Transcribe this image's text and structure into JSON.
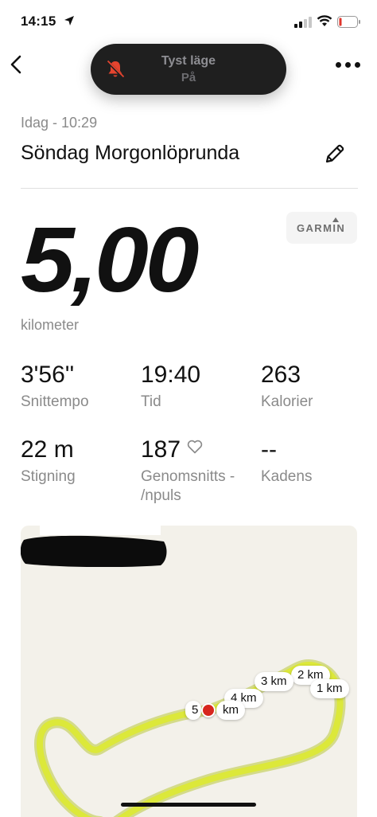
{
  "status_bar": {
    "time": "14:15"
  },
  "silent_mode": {
    "title": "Tyst läge",
    "subtitle": "På"
  },
  "activity": {
    "date": "Idag - 10:29",
    "title": "Söndag Morgonlöprunda",
    "source": "GARMIN",
    "distance": "5,00",
    "distance_unit": "kilometer"
  },
  "stats": [
    {
      "value": "3'56''",
      "label": "Snittempo"
    },
    {
      "value": "19:40",
      "label": "Tid"
    },
    {
      "value": "263",
      "label": "Kalorier"
    },
    {
      "value": "22 m",
      "label": "Stigning"
    },
    {
      "value": "187",
      "label": "Genomsnitts - /npuls"
    },
    {
      "value": "--",
      "label": "Kadens"
    }
  ],
  "map": {
    "markers": [
      "1 km",
      "2 km",
      "3 km",
      "4 km",
      "5",
      "km"
    ]
  },
  "colors": {
    "route": "#dce83a",
    "end_marker": "#d7261d"
  }
}
